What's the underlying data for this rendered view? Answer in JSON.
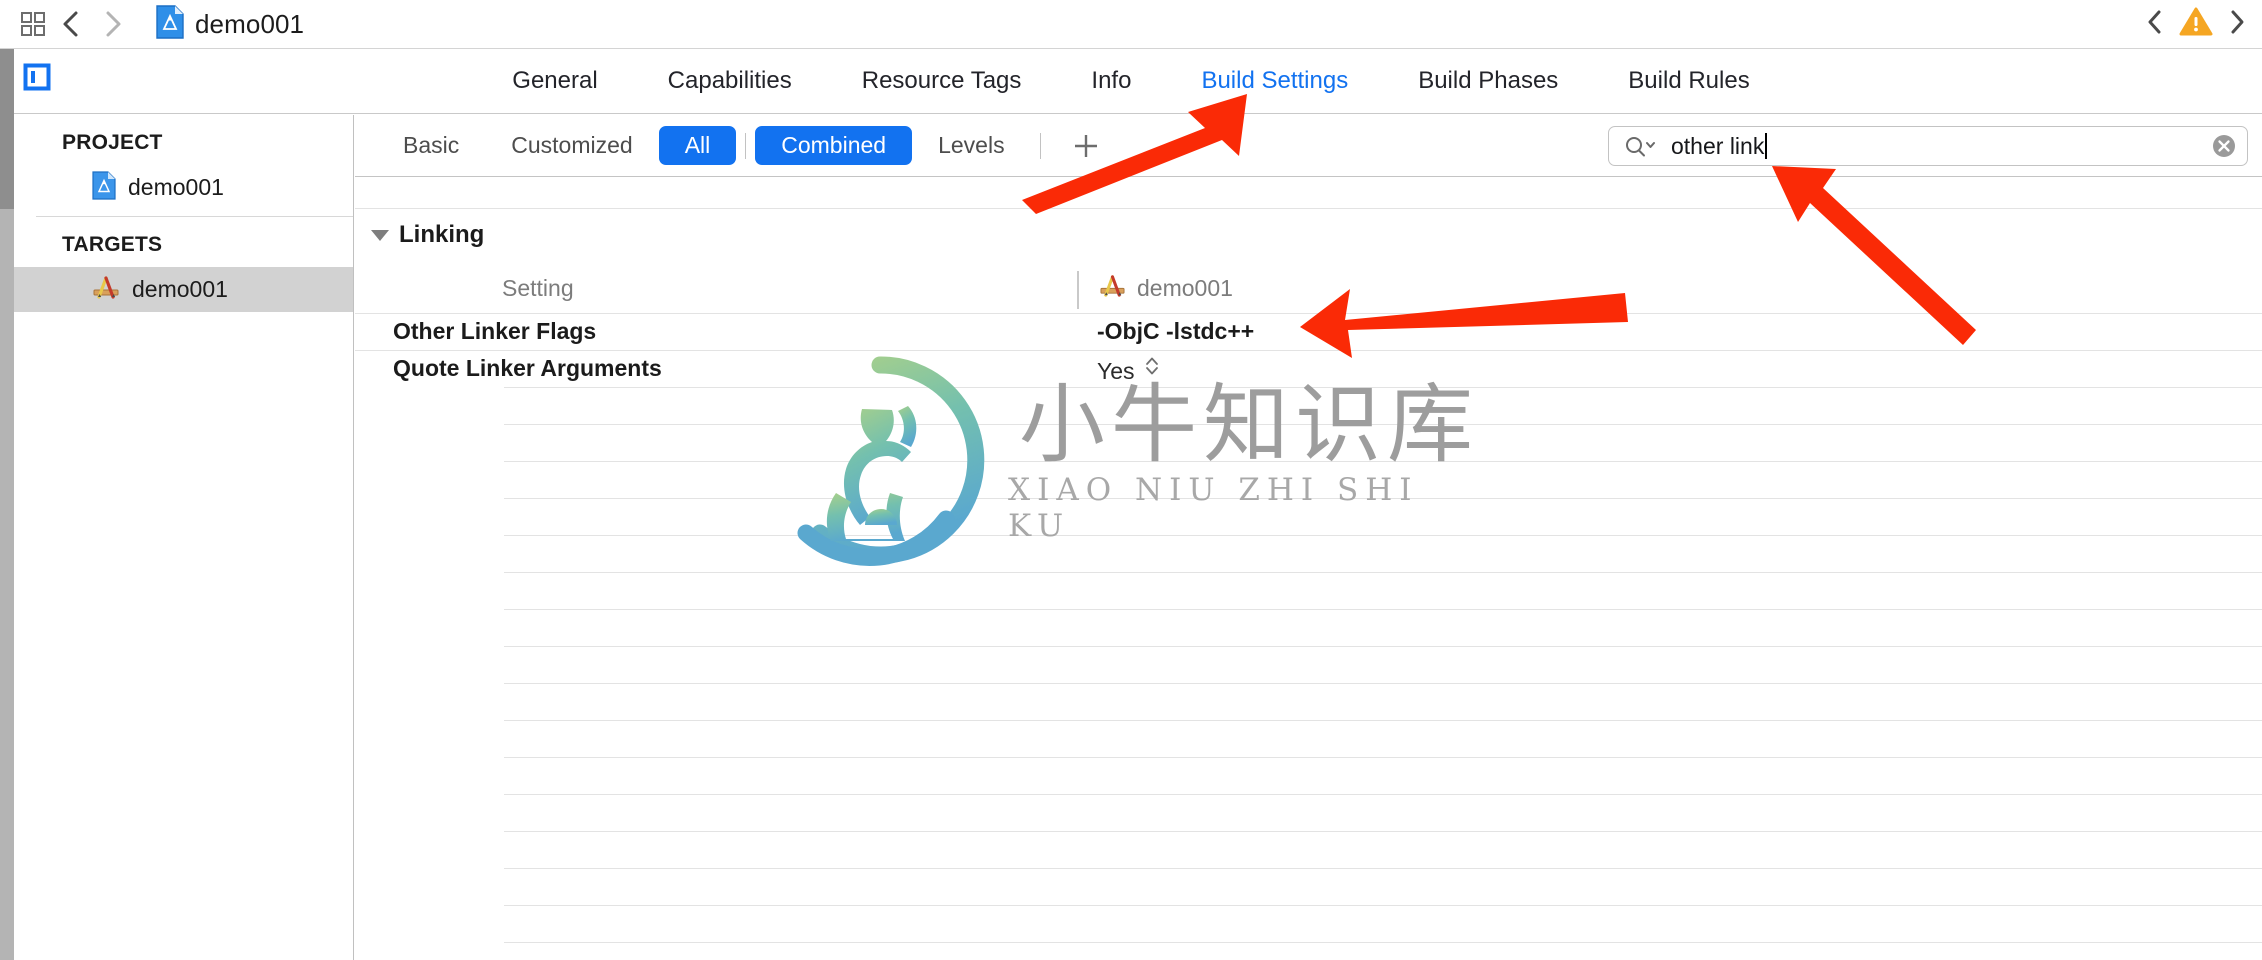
{
  "toolbar": {
    "grid_icon": "grid-icon",
    "back_icon": "chevron-left-icon",
    "forward_icon": "chevron-right-icon",
    "document_icon": "xcode-project-icon",
    "document_title": "demo001",
    "issue_prev_icon": "chevron-left-icon",
    "warning_icon": "warning-triangle-icon",
    "issue_next_icon": "chevron-right-icon"
  },
  "sidebar_toggle": {
    "icon": "sidebar-left-icon"
  },
  "tabs": [
    {
      "label": "General",
      "active": false
    },
    {
      "label": "Capabilities",
      "active": false
    },
    {
      "label": "Resource Tags",
      "active": false
    },
    {
      "label": "Info",
      "active": false
    },
    {
      "label": "Build Settings",
      "active": true
    },
    {
      "label": "Build Phases",
      "active": false
    },
    {
      "label": "Build Rules",
      "active": false
    }
  ],
  "sidebar": {
    "project_header": "PROJECT",
    "project_items": [
      {
        "label": "demo001",
        "icon": "xcode-project-icon",
        "selected": false
      }
    ],
    "targets_header": "TARGETS",
    "target_items": [
      {
        "label": "demo001",
        "icon": "xcode-target-icon",
        "selected": true
      }
    ]
  },
  "filterbar": {
    "scope_buttons": [
      {
        "label": "Basic",
        "on": false
      },
      {
        "label": "Customized",
        "on": false
      },
      {
        "label": "All",
        "on": true
      }
    ],
    "view_buttons": [
      {
        "label": "Combined",
        "on": true
      },
      {
        "label": "Levels",
        "on": false
      }
    ],
    "add_button_icon": "plus-icon"
  },
  "search": {
    "icon": "search-magnifier-icon",
    "dropdown_icon": "chevron-down-icon",
    "value": "other link",
    "placeholder": "",
    "clear_icon": "clear-circle-icon"
  },
  "settings": {
    "group": {
      "label": "Linking",
      "expanded": true,
      "disclosure_icon": "triangle-down-icon"
    },
    "columns": {
      "setting": "Setting",
      "target": "demo001",
      "target_icon": "xcode-target-icon"
    },
    "rows": [
      {
        "name": "Other Linker Flags",
        "value": "-ObjC -lstdc++",
        "bold": true,
        "stepper": false
      },
      {
        "name": "Quote Linker Arguments",
        "value": "Yes",
        "bold": false,
        "stepper": true
      }
    ],
    "empty_row_count": 16
  },
  "watermark": {
    "chinese": "小牛知识库",
    "pinyin": "XIAO NIU ZHI SHI KU",
    "logo": "ox-circle-logo"
  },
  "annotations": {
    "arrow_color": "#FA2A06",
    "arrows": [
      {
        "name": "arrow-to-build-settings-tab"
      },
      {
        "name": "arrow-to-search-field"
      },
      {
        "name": "arrow-to-other-linker-flags-value"
      }
    ]
  },
  "colors": {
    "accent_blue": "#1272f0",
    "selected_row_gray": "#d2d2d2",
    "warning_amber": "#f5a623",
    "separator": "#e3e3e3"
  }
}
